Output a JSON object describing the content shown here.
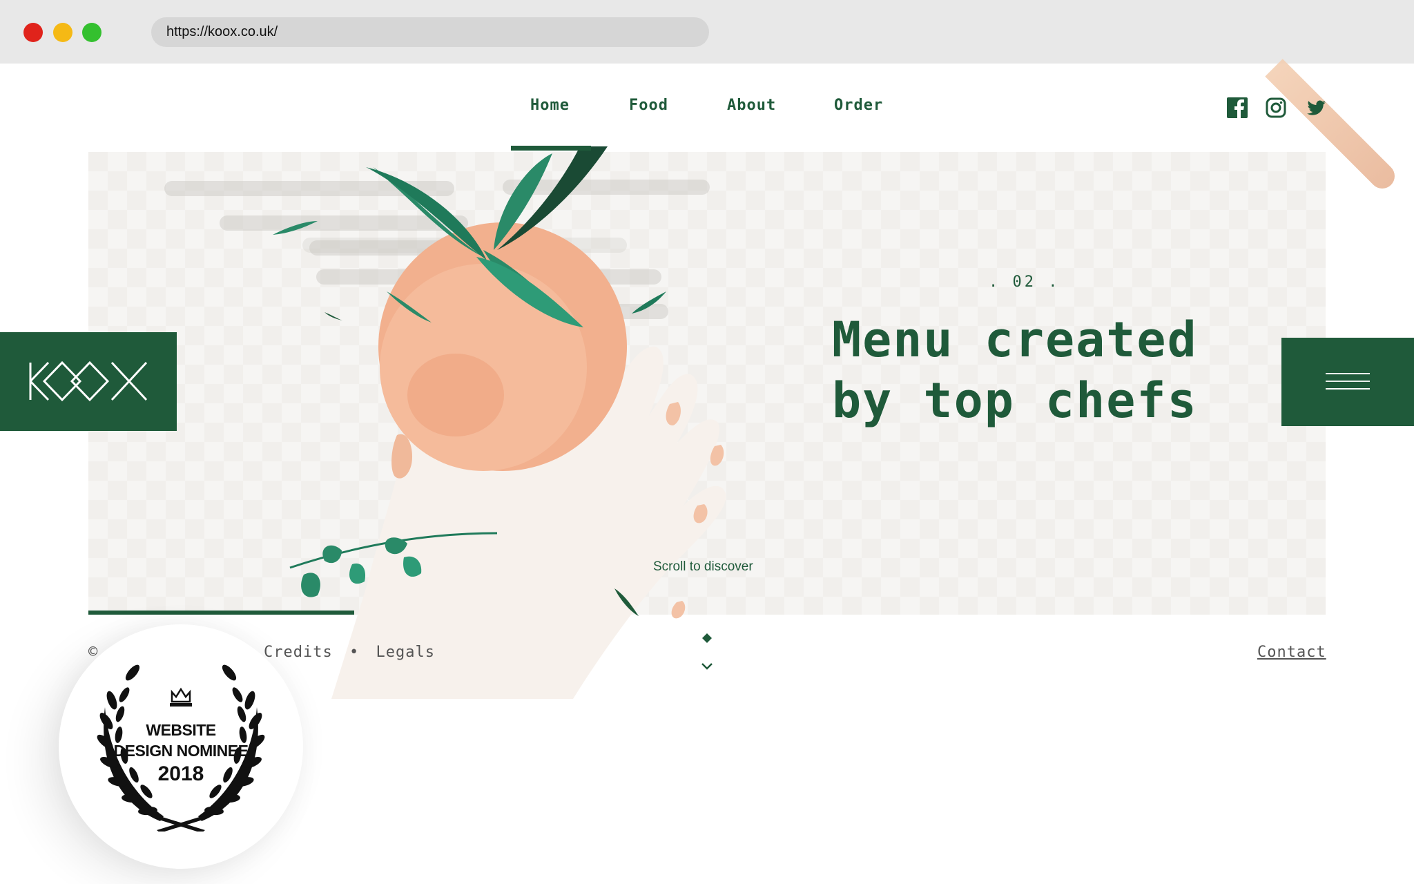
{
  "browser": {
    "url": "https://koox.co.uk/",
    "traffic_lights": {
      "close": "#e0231b",
      "minimize": "#f5b915",
      "zoom": "#34c02f"
    }
  },
  "nav": {
    "items": [
      {
        "label": "Home",
        "active": true
      },
      {
        "label": "Food"
      },
      {
        "label": "About"
      },
      {
        "label": "Order"
      }
    ],
    "social": [
      "facebook-icon",
      "instagram-icon",
      "twitter-icon"
    ]
  },
  "brand": {
    "logo_text": "KOOX",
    "primary_color": "#1f5a3a"
  },
  "hero": {
    "slide_number": ". 02 .",
    "headline_line1": "Menu created",
    "headline_line2": "by top chefs",
    "scroll_hint": "Scroll to discover"
  },
  "footer": {
    "copyright_symbol": "©",
    "credits": "Credits",
    "separator": "•",
    "legals": "Legals",
    "contact": "Contact"
  },
  "award": {
    "line1": "WEBSITE",
    "line2": "DESIGN NOMINEE",
    "year": "2018"
  }
}
